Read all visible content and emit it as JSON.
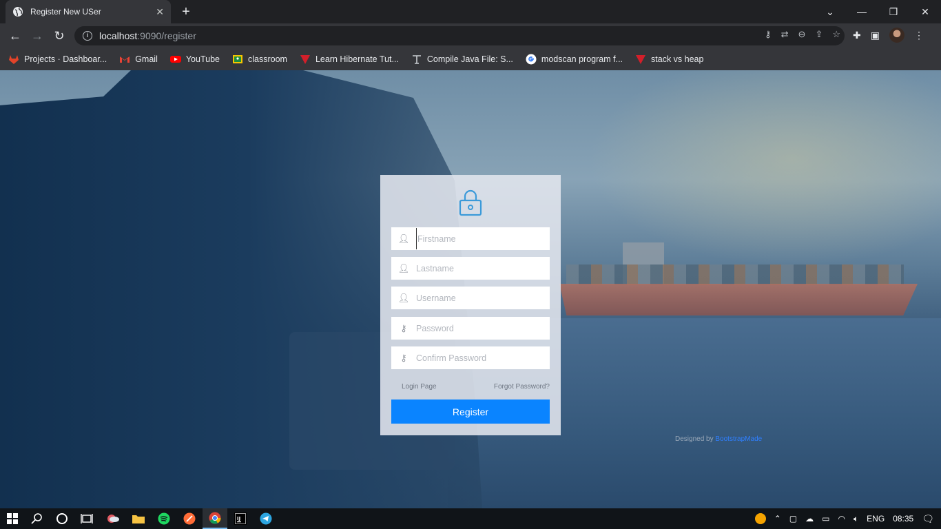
{
  "browser": {
    "tab_title": "Register New USer",
    "url_host": "localhost",
    "url_rest": ":9090/register",
    "bookmarks": [
      {
        "label": "Projects · Dashboar...",
        "icon": "gitlab-icon"
      },
      {
        "label": "Gmail",
        "icon": "gmail-icon"
      },
      {
        "label": "YouTube",
        "icon": "youtube-icon"
      },
      {
        "label": "classroom",
        "icon": "classroom-icon"
      },
      {
        "label": "Learn Hibernate Tut...",
        "icon": "tutorial-icon"
      },
      {
        "label": "Compile Java File: S...",
        "icon": "text-icon"
      },
      {
        "label": "modscan program f...",
        "icon": "google-icon"
      },
      {
        "label": "stack vs heap",
        "icon": "tutorial-icon"
      }
    ]
  },
  "form": {
    "fields": [
      {
        "placeholder": "Firstname",
        "icon": "user-icon"
      },
      {
        "placeholder": "Lastname",
        "icon": "user-icon"
      },
      {
        "placeholder": "Username",
        "icon": "user-icon"
      },
      {
        "placeholder": "Password",
        "icon": "key-icon"
      },
      {
        "placeholder": "Confirm Password",
        "icon": "key-icon"
      }
    ],
    "login_link": "Login Page",
    "forgot_link": "Forgot Password?",
    "submit_label": "Register"
  },
  "footer": {
    "designed_by": "Designed by ",
    "brand": "BootstrapMade"
  },
  "taskbar": {
    "language": "ENG",
    "time": "08:35"
  },
  "colors": {
    "accent": "#0a84ff",
    "lock_icon": "#3b9ad9"
  }
}
